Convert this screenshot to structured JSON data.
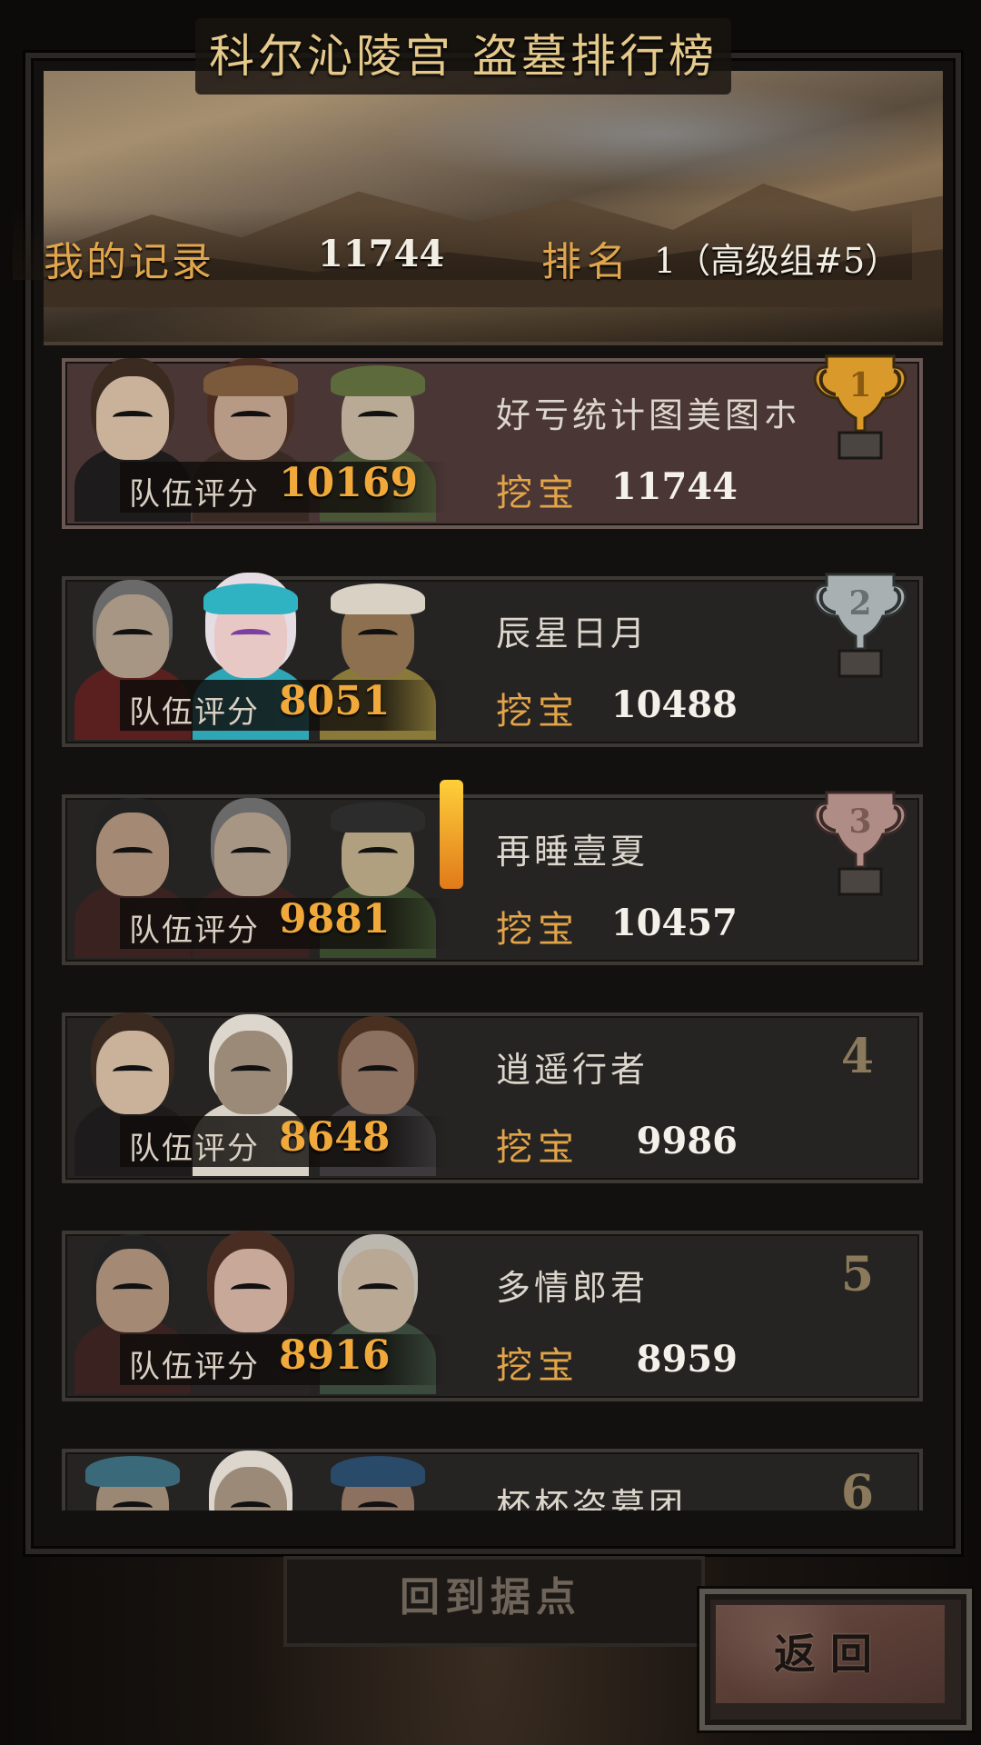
{
  "header": {
    "title": "科尔沁陵宫 盗墓排行榜",
    "my_record_label": "我的记录",
    "my_record_value": "11744",
    "rank_label": "排名",
    "rank_value": "1（高级组#5）"
  },
  "list": {
    "team_score_label": "队伍评分",
    "dig_label": "挖宝",
    "entries": [
      {
        "name": "好亏统计图美图ホ",
        "team_score": "10169",
        "dig_value": "11744",
        "rank": "1",
        "trophy": "gold-trophy"
      },
      {
        "name": "辰星日月",
        "team_score": "8051",
        "dig_value": "10488",
        "rank": "2",
        "trophy": "silver-trophy"
      },
      {
        "name": "再睡壹夏",
        "team_score": "9881",
        "dig_value": "10457",
        "rank": "3",
        "trophy": "bronze-trophy"
      },
      {
        "name": "逍遥行者",
        "team_score": "8648",
        "dig_value": "9986",
        "rank": "4"
      },
      {
        "name": "多情郎君",
        "team_score": "8916",
        "dig_value": "8959",
        "rank": "5"
      },
      {
        "name": "杯杯盗墓团",
        "rank": "6"
      }
    ]
  },
  "buttons": {
    "home_label": "回到据点",
    "back_label": "返回"
  },
  "colors": {
    "gold": "#e0a64e",
    "gold_trophy": "#d99a2b",
    "silver_trophy": "#a9b0b2",
    "bronze_trophy": "#b08c86",
    "first_row_bg": "#4a3735",
    "row_bg": "#262422"
  }
}
